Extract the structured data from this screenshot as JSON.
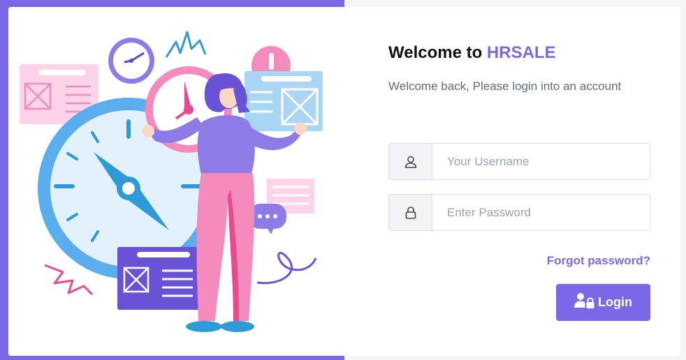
{
  "welcome": {
    "prefix": "Welcome to ",
    "brand": "HRSALE",
    "subtitle": "Welcome back, Please login into an account"
  },
  "form": {
    "username_placeholder": "Your Username",
    "password_placeholder": "Enter Password",
    "username_icon": "user-icon",
    "password_icon": "lock-icon",
    "forgot_label": "Forgot password?",
    "login_label": "Login",
    "login_icon": "user-lock-icon"
  },
  "colors": {
    "accent": "#7a68e8",
    "page_background": "#f4f5f7",
    "card_background": "#ffffff",
    "title_text": "#111111",
    "subtitle_text": "#5f6b7a"
  }
}
